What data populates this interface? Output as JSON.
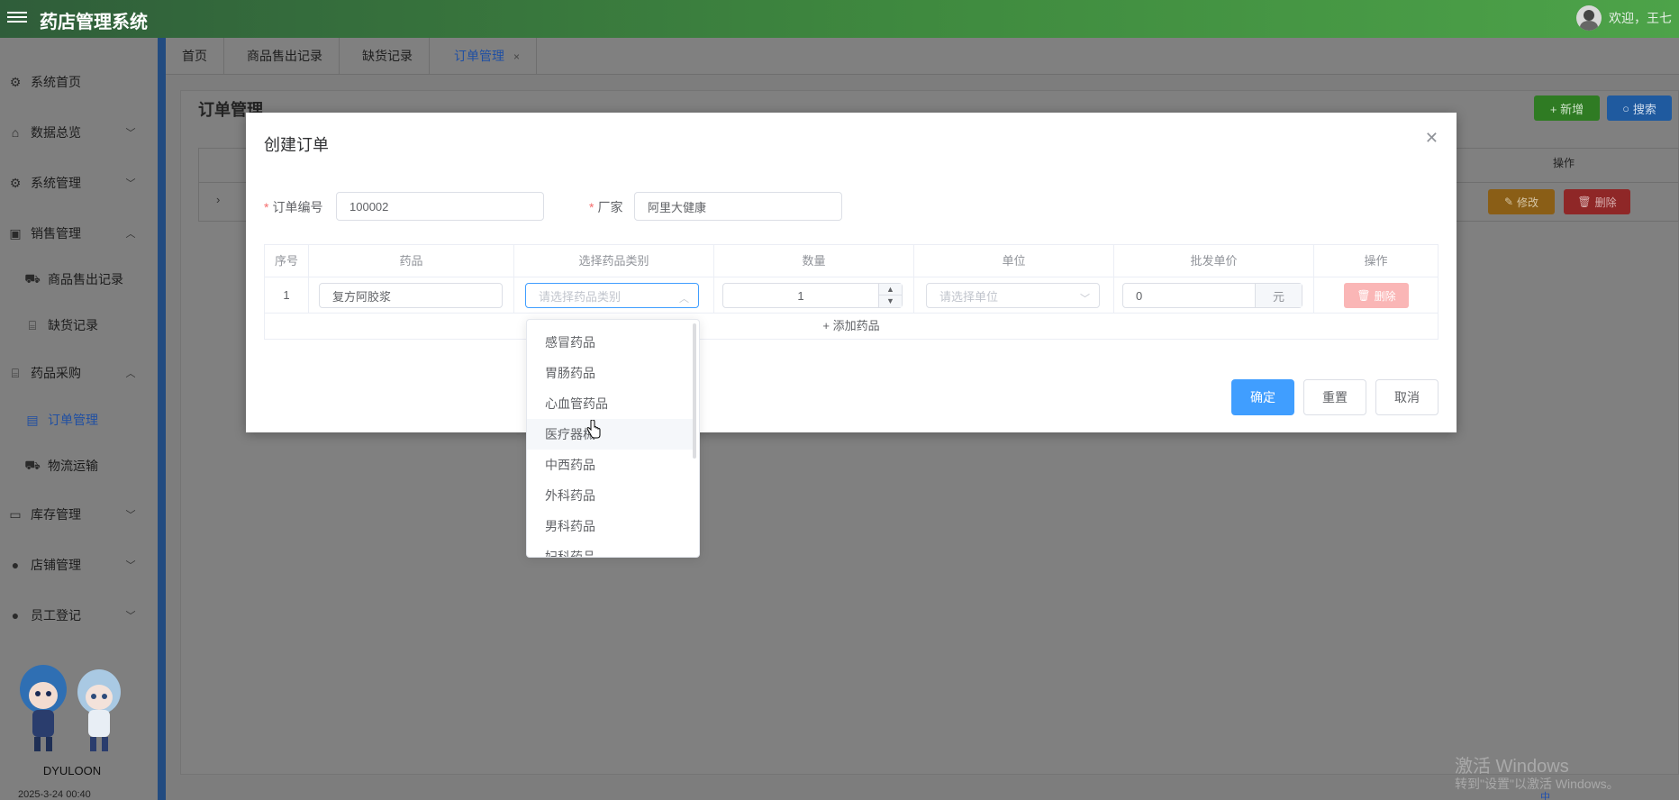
{
  "header": {
    "title": "药店管理系统",
    "welcome": "欢迎，王七"
  },
  "sidebar": {
    "items": [
      {
        "label": "系统首页",
        "icon": "gear-icon"
      },
      {
        "label": "数据总览",
        "icon": "home-icon"
      },
      {
        "label": "系统管理",
        "icon": "gear-icon"
      },
      {
        "label": "销售管理",
        "icon": "chart-icon"
      },
      {
        "label": "商品售出记录",
        "icon": "truck-icon"
      },
      {
        "label": "缺货记录",
        "icon": "bag-icon"
      },
      {
        "label": "药品采购",
        "icon": "bag-icon"
      },
      {
        "label": "订单管理",
        "icon": "document-icon"
      },
      {
        "label": "物流运输",
        "icon": "truck-icon"
      },
      {
        "label": "库存管理",
        "icon": "box-icon"
      },
      {
        "label": "店铺管理",
        "icon": "user-icon"
      },
      {
        "label": "员工登记",
        "icon": "user-icon"
      }
    ],
    "brand": "DYULOON",
    "date": "2025-3-24 00:40"
  },
  "tabs": [
    {
      "label": "首页"
    },
    {
      "label": "商品售出记录"
    },
    {
      "label": "缺货记录"
    },
    {
      "label": "订单管理"
    }
  ],
  "page": {
    "title": "订单管理",
    "add_label": "+ 新增",
    "search_label": "搜索",
    "op_header": "操作",
    "edit_label": "修改",
    "delete_label": "删除"
  },
  "dialog": {
    "title": "创建订单",
    "order_no_label": "订单编号",
    "order_no_value": "100002",
    "vendor_label": "厂家",
    "vendor_value": "阿里大健康",
    "columns": [
      "序号",
      "药品",
      "选择药品类别",
      "数量",
      "单位",
      "批发单价",
      "操作"
    ],
    "row": {
      "index": "1",
      "drug": "复方阿胶浆",
      "category_placeholder": "请选择药品类别",
      "quantity": "1",
      "unit_placeholder": "请选择单位",
      "price": "0",
      "price_unit": "元",
      "delete_label": "删除"
    },
    "add_drug_label": "+ 添加药品",
    "confirm_label": "确定",
    "reset_label": "重置",
    "cancel_label": "取消"
  },
  "dropdown": {
    "options": [
      "感冒药品",
      "胃肠药品",
      "心血管药品",
      "医疗器械",
      "中西药品",
      "外科药品",
      "男科药品",
      "妇科药品"
    ]
  },
  "watermark": {
    "line1": "激活 Windows",
    "line2": "转到\"设置\"以激活 Windows。"
  },
  "taskbar": {
    "ime": "中"
  },
  "colors": {
    "primary": "#409eff",
    "header_green": "#3f8a3f",
    "danger_light": "#fab6b6"
  }
}
